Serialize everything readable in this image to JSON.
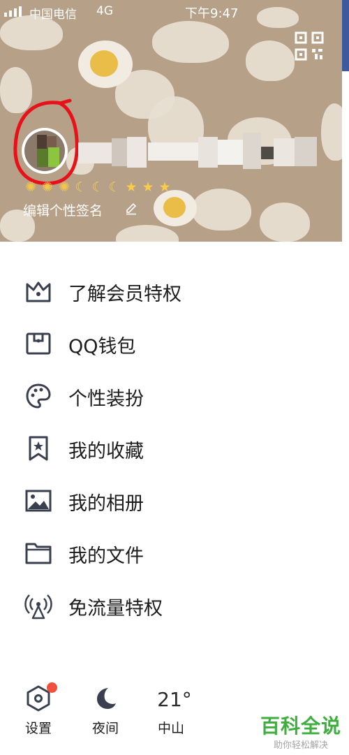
{
  "status_bar": {
    "carrier": "中国电信",
    "network": "4G",
    "time": "下午9:47"
  },
  "profile": {
    "signature": "编辑个性签名",
    "level_icons": [
      "sun",
      "sun",
      "sun",
      "moon",
      "moon",
      "moon",
      "star",
      "star",
      "star"
    ]
  },
  "menu": {
    "items": [
      {
        "label": "了解会员特权",
        "icon": "crown-icon"
      },
      {
        "label": "QQ钱包",
        "icon": "wallet-icon"
      },
      {
        "label": "个性装扮",
        "icon": "palette-icon"
      },
      {
        "label": "我的收藏",
        "icon": "bookmark-star-icon"
      },
      {
        "label": "我的相册",
        "icon": "photo-album-icon"
      },
      {
        "label": "我的文件",
        "icon": "folder-icon"
      },
      {
        "label": "免流量特权",
        "icon": "antenna-icon"
      }
    ]
  },
  "bottom_bar": {
    "settings_label": "设置",
    "night_label": "夜间",
    "temperature": "21°",
    "city": "中山"
  },
  "watermark": {
    "title": "百科全说",
    "subtitle": "助你轻松解决"
  },
  "colors": {
    "header_bg": "#b7a088",
    "highlight_circle": "#e8111a",
    "icon_color": "#3a3f4f",
    "badge": "#f0503c",
    "watermark_green": "#3eae3e"
  }
}
